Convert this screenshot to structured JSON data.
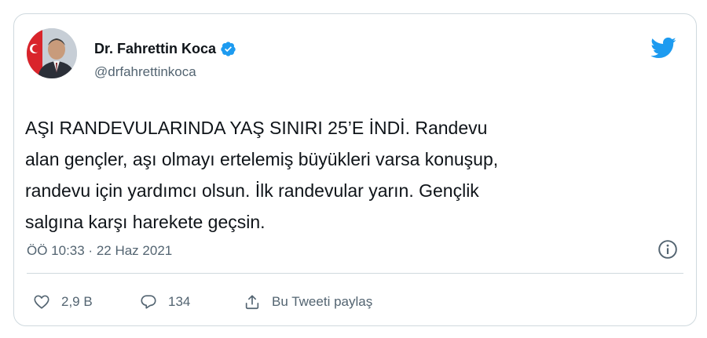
{
  "author": {
    "display_name": "Dr. Fahrettin Koca",
    "handle": "@drfahrettinkoca",
    "verified": true
  },
  "tweet": {
    "text": "AŞI RANDEVULARINDA YAŞ SINIRI 25’E İNDİ. Randevu\nalan gençler, aşı olmayı ertelemiş büyükleri varsa konuşup,\nrandevu için yardımcı olsun. İlk randevular yarın. Gençlik\nsalgına karşı harekete geçsin.",
    "timestamp": "ÖÖ 10:33 · 22 Haz 2021"
  },
  "actions": {
    "likes": "2,9 B",
    "replies": "134",
    "share_label": "Bu Tweeti paylaş"
  },
  "icons": {
    "brand": "twitter-bird-icon",
    "verified": "verified-badge-icon",
    "info": "info-icon",
    "like": "heart-icon",
    "reply": "speech-bubble-icon",
    "share": "share-icon"
  },
  "colors": {
    "twitter_blue": "#1d9bf0",
    "secondary_text": "#536471",
    "border": "#cfd9de"
  }
}
